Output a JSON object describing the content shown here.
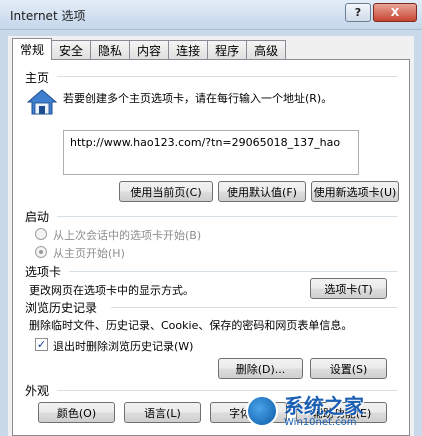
{
  "window": {
    "title": "Internet 选项",
    "help_label": "?",
    "close_label": "X"
  },
  "tabs": [
    "常规",
    "安全",
    "隐私",
    "内容",
    "连接",
    "程序",
    "高级"
  ],
  "home": {
    "section_title": "主页",
    "description": "若要创建多个主页选项卡，请在每行输入一个地址(R)。",
    "url_value": "http://www.hao123.com/?tn=29065018_137_hao",
    "btn_current": "使用当前页(C)",
    "btn_default": "使用默认值(F)",
    "btn_new_tab": "使用新选项卡(U)"
  },
  "startup": {
    "section_title": "启动",
    "option_last_session": "从上次会话中的选项卡开始(B)",
    "option_home": "从主页开始(H)"
  },
  "tabs_section": {
    "section_title": "选项卡",
    "description": "更改网页在选项卡中的显示方式。",
    "btn_tabs": "选项卡(T)"
  },
  "history": {
    "section_title": "浏览历史记录",
    "description": "删除临时文件、历史记录、Cookie、保存的密码和网页表单信息。",
    "checkbox_label": "退出时删除浏览历史记录(W)",
    "btn_delete": "删除(D)...",
    "btn_settings": "设置(S)"
  },
  "appearance": {
    "section_title": "外观",
    "btn_colors": "颜色(O)",
    "btn_languages": "语言(L)",
    "btn_fonts": "字体(N)",
    "btn_accessibility": "辅助功能(E)"
  },
  "watermark": {
    "title": "系统之家",
    "subtitle": "Win10net.com"
  }
}
